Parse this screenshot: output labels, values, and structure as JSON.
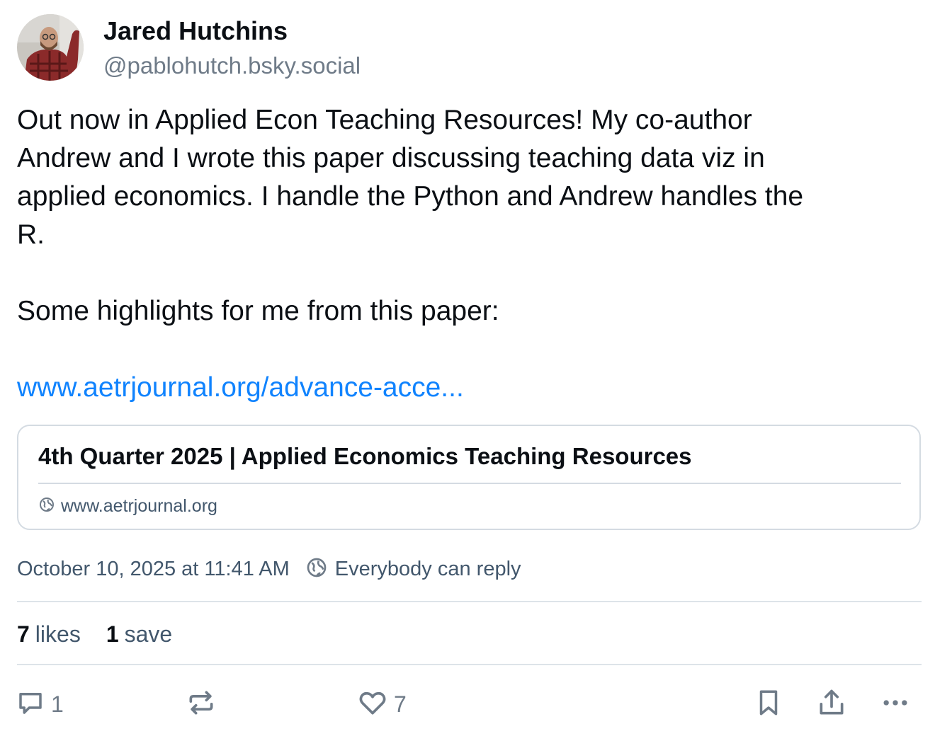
{
  "author": {
    "name": "Jared Hutchins",
    "handle": "@pablohutch.bsky.social"
  },
  "post": {
    "lines": [
      "Out now in Applied Econ Teaching Resources! My co-author",
      "Andrew and I wrote this paper discussing teaching data viz in",
      "applied economics. I handle the Python and Andrew handles the",
      "R."
    ],
    "highlight_line": "Some highlights for me from this paper:",
    "link_text": "www.aetrjournal.org/advance-acce..."
  },
  "embed": {
    "title": "4th Quarter 2025 | Applied Economics Teaching Resources",
    "domain": "www.aetrjournal.org"
  },
  "meta": {
    "timestamp": "October 10, 2025 at 11:41 AM",
    "reply_setting": "Everybody can reply"
  },
  "stats": {
    "likes_count": "7",
    "likes_label": "likes",
    "saves_count": "1",
    "saves_label": "save"
  },
  "actions": {
    "reply_count": "1",
    "like_count": "7"
  },
  "colors": {
    "link": "#1083fe",
    "muted_text": "#42576c",
    "icon": "#6f7b88",
    "border": "#d4dbe2"
  }
}
